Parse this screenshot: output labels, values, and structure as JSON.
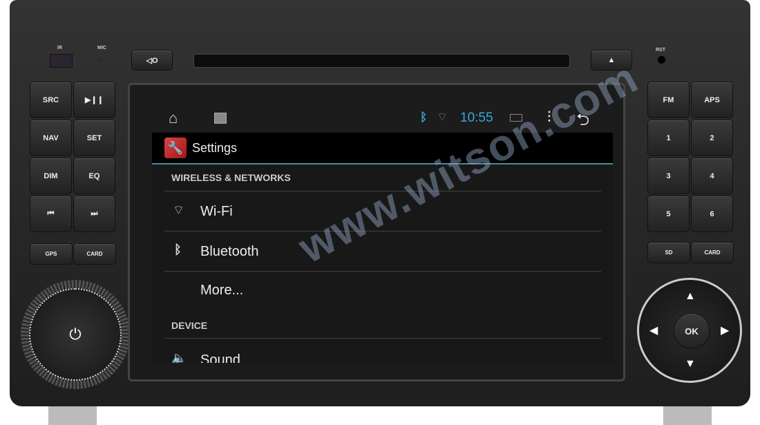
{
  "device": {
    "ir_label": "IR",
    "mic_label": "MIC",
    "rst_label": "RST",
    "left_buttons": [
      {
        "label": "SRC"
      },
      {
        "label": "▶❙❙"
      },
      {
        "label": "NAV"
      },
      {
        "label": "SET"
      },
      {
        "label": "DIM"
      },
      {
        "label": "EQ"
      },
      {
        "label": "⏮"
      },
      {
        "label": "⏭"
      }
    ],
    "left_bottom": [
      "GPS",
      "CARD"
    ],
    "right_buttons": [
      {
        "label": "FM"
      },
      {
        "label": "APS"
      },
      {
        "label": "1"
      },
      {
        "label": "2"
      },
      {
        "label": "3"
      },
      {
        "label": "4"
      },
      {
        "label": "5"
      },
      {
        "label": "6"
      }
    ],
    "right_bottom": [
      "SD",
      "CARD"
    ],
    "dpad": {
      "ok": "OK",
      "up": "▲",
      "down": "▼",
      "left": "◀",
      "right": "▶"
    },
    "power": "⏻",
    "mode_icon": "◁O",
    "eject": "▲"
  },
  "status_bar": {
    "time": "10:55",
    "accent": "#3aa7d8"
  },
  "action_bar": {
    "title": "Settings"
  },
  "settings": {
    "section1": "WIRELESS & NETWORKS",
    "items1": [
      {
        "label": "Wi-Fi",
        "icon": "wifi-icon"
      },
      {
        "label": "Bluetooth",
        "icon": "bluetooth-icon"
      },
      {
        "label": "More..."
      }
    ],
    "section2": "DEVICE",
    "items2": [
      {
        "label": "Sound",
        "icon": "speaker-icon"
      }
    ]
  },
  "watermark": "www.witson.com"
}
